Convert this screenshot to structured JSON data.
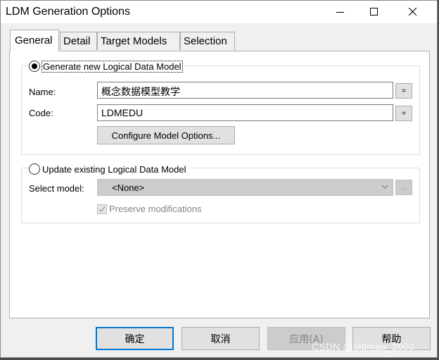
{
  "window": {
    "title": "LDM Generation Options"
  },
  "tabs": [
    {
      "label": "General",
      "active": true
    },
    {
      "label": "Detail",
      "active": false
    },
    {
      "label": "Target Models",
      "active": false
    },
    {
      "label": "Selection",
      "active": false
    }
  ],
  "generate_group": {
    "radio_label": "Generate new Logical Data Model",
    "selected": true,
    "name_label": "Name:",
    "name_value": "概念数据模型教学",
    "code_label": "Code:",
    "code_value": "LDMEDU",
    "equals_label": "=",
    "configure_button": "Configure Model Options..."
  },
  "update_group": {
    "radio_label": "Update existing Logical Data Model",
    "selected": false,
    "select_model_label": "Select model:",
    "select_model_value": "<None>",
    "browse_label": "...",
    "preserve_label": "Preserve modifications",
    "preserve_checked": true
  },
  "footer": {
    "ok": "确定",
    "cancel": "取消",
    "apply": "应用(A)",
    "help": "帮助"
  },
  "watermark": "CSDN @oldmao_2000",
  "colors": {
    "accent": "#0078d7",
    "disabled": "#cccccc"
  }
}
